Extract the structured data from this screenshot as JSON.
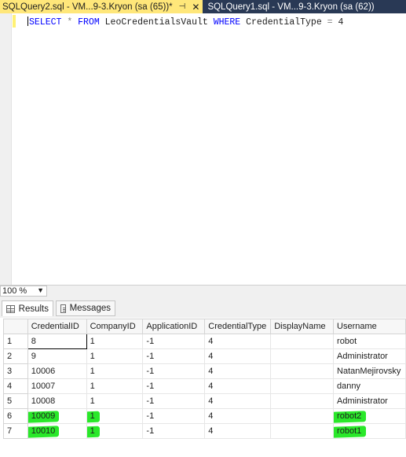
{
  "tabs": {
    "active_title": "SQLQuery2.sql - VM...9-3.Kryon (sa (65))*",
    "pin_glyph": "⊣",
    "close_glyph": "✕",
    "inactive_title": "SQLQuery1.sql - VM...9-3.Kryon (sa (62))"
  },
  "editor": {
    "kw_select": "SELECT",
    "star": "*",
    "kw_from": "FROM",
    "table": "LeoCredentialsVault",
    "kw_where": "WHERE",
    "column": "CredentialType",
    "eq": "=",
    "value": "4"
  },
  "zoom": {
    "value": "100 %"
  },
  "result_tabs": {
    "results": "Results",
    "messages": "Messages"
  },
  "grid": {
    "columns": [
      "CredentialID",
      "CompanyID",
      "ApplicationID",
      "CredentialType",
      "DisplayName",
      "Username"
    ],
    "rows": [
      {
        "n": "1",
        "cred": "8",
        "company": "1",
        "app": "-1",
        "type": "4",
        "display": "",
        "user": "robot"
      },
      {
        "n": "2",
        "cred": "9",
        "company": "1",
        "app": "-1",
        "type": "4",
        "display": "",
        "user": "Administrator"
      },
      {
        "n": "3",
        "cred": "10006",
        "company": "1",
        "app": "-1",
        "type": "4",
        "display": "",
        "user": "NatanMejirovsky"
      },
      {
        "n": "4",
        "cred": "10007",
        "company": "1",
        "app": "-1",
        "type": "4",
        "display": "",
        "user": "danny"
      },
      {
        "n": "5",
        "cred": "10008",
        "company": "1",
        "app": "-1",
        "type": "4",
        "display": "",
        "user": "Administrator"
      },
      {
        "n": "6",
        "cred": "10009",
        "company": "1",
        "app": "-1",
        "type": "4",
        "display": "",
        "user": "robot2"
      },
      {
        "n": "7",
        "cred": "10010",
        "company": "1",
        "app": "-1",
        "type": "4",
        "display": "",
        "user": "robot1"
      }
    ]
  },
  "colors": {
    "tab_strip": "#293955",
    "active_tab": "#ffe77a",
    "highlight": "#2ae82a",
    "keyword": "#0000ff"
  }
}
